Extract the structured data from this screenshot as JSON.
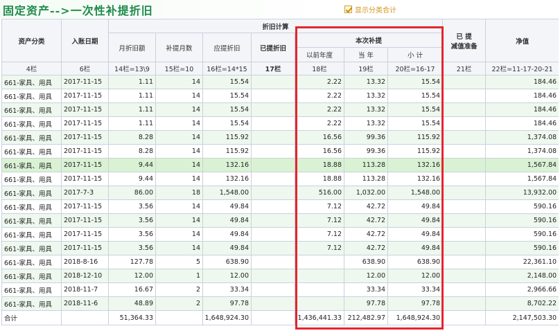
{
  "header": {
    "title": "固定资产-->一次性补提折旧",
    "summary_toggle": {
      "label": "显示分类合计",
      "checked": true
    }
  },
  "columns": {
    "category": "资产分类",
    "entry_date": "入账日期",
    "depr_group": "折旧计算",
    "monthly_depr": "月折旧额",
    "months": "补提月数",
    "due_depr": "应提折旧",
    "accrued_depr": "已提折旧",
    "current_group": "本次补提",
    "prior_years": "以前年度",
    "this_year": "当 年",
    "subtotal": "小 计",
    "impairment_top": "已 提",
    "impairment_bottom": "减值准备",
    "net_value": "净值"
  },
  "formula_row": [
    "4栏",
    "6栏",
    "14栏=13\\9",
    "15栏=10",
    "16栏=14*15",
    "17栏",
    "18栏",
    "19栏",
    "20栏=16-17",
    "21栏",
    "22栏=11-17-20-21"
  ],
  "rows": [
    {
      "category": "661-家具、用具",
      "entry_date": "2017-11-15",
      "monthly_depr": "1.11",
      "months": "14",
      "due_depr": "15.54",
      "accrued_depr": "",
      "prior_years": "2.22",
      "this_year": "13.32",
      "subtotal": "15.54",
      "impairment": "",
      "net_value": "184.46"
    },
    {
      "category": "661-家具、用具",
      "entry_date": "2017-11-15",
      "monthly_depr": "1.11",
      "months": "14",
      "due_depr": "15.54",
      "accrued_depr": "",
      "prior_years": "2.22",
      "this_year": "13.32",
      "subtotal": "15.54",
      "impairment": "",
      "net_value": "184.46"
    },
    {
      "category": "661-家具、用具",
      "entry_date": "2017-11-15",
      "monthly_depr": "1.11",
      "months": "14",
      "due_depr": "15.54",
      "accrued_depr": "",
      "prior_years": "2.22",
      "this_year": "13.32",
      "subtotal": "15.54",
      "impairment": "",
      "net_value": "184.46"
    },
    {
      "category": "661-家具、用具",
      "entry_date": "2017-11-15",
      "monthly_depr": "1.11",
      "months": "14",
      "due_depr": "15.54",
      "accrued_depr": "",
      "prior_years": "2.22",
      "this_year": "13.32",
      "subtotal": "15.54",
      "impairment": "",
      "net_value": "184.46"
    },
    {
      "category": "661-家具、用具",
      "entry_date": "2017-11-15",
      "monthly_depr": "8.28",
      "months": "14",
      "due_depr": "115.92",
      "accrued_depr": "",
      "prior_years": "16.56",
      "this_year": "99.36",
      "subtotal": "115.92",
      "impairment": "",
      "net_value": "1,374.08"
    },
    {
      "category": "661-家具、用具",
      "entry_date": "2017-11-15",
      "monthly_depr": "8.28",
      "months": "14",
      "due_depr": "115.92",
      "accrued_depr": "",
      "prior_years": "16.56",
      "this_year": "99.36",
      "subtotal": "115.92",
      "impairment": "",
      "net_value": "1,374.08"
    },
    {
      "category": "661-家具、用具",
      "entry_date": "2017-11-15",
      "monthly_depr": "9.44",
      "months": "14",
      "due_depr": "132.16",
      "accrued_depr": "",
      "prior_years": "18.88",
      "this_year": "113.28",
      "subtotal": "132.16",
      "impairment": "",
      "net_value": "1,567.84",
      "selected": true
    },
    {
      "category": "661-家具、用具",
      "entry_date": "2017-11-15",
      "monthly_depr": "9.44",
      "months": "14",
      "due_depr": "132.16",
      "accrued_depr": "",
      "prior_years": "18.88",
      "this_year": "113.28",
      "subtotal": "132.16",
      "impairment": "",
      "net_value": "1,567.84"
    },
    {
      "category": "661-家具、用具",
      "entry_date": "2017-7-3",
      "monthly_depr": "86.00",
      "months": "18",
      "due_depr": "1,548.00",
      "accrued_depr": "",
      "prior_years": "516.00",
      "this_year": "1,032.00",
      "subtotal": "1,548.00",
      "impairment": "",
      "net_value": "13,932.00"
    },
    {
      "category": "661-家具、用具",
      "entry_date": "2017-11-15",
      "monthly_depr": "3.56",
      "months": "14",
      "due_depr": "49.84",
      "accrued_depr": "",
      "prior_years": "7.12",
      "this_year": "42.72",
      "subtotal": "49.84",
      "impairment": "",
      "net_value": "590.16"
    },
    {
      "category": "661-家具、用具",
      "entry_date": "2017-11-15",
      "monthly_depr": "3.56",
      "months": "14",
      "due_depr": "49.84",
      "accrued_depr": "",
      "prior_years": "7.12",
      "this_year": "42.72",
      "subtotal": "49.84",
      "impairment": "",
      "net_value": "590.16"
    },
    {
      "category": "661-家具、用具",
      "entry_date": "2017-11-15",
      "monthly_depr": "3.56",
      "months": "14",
      "due_depr": "49.84",
      "accrued_depr": "",
      "prior_years": "7.12",
      "this_year": "42.72",
      "subtotal": "49.84",
      "impairment": "",
      "net_value": "590.16"
    },
    {
      "category": "661-家具、用具",
      "entry_date": "2017-11-15",
      "monthly_depr": "3.56",
      "months": "14",
      "due_depr": "49.84",
      "accrued_depr": "",
      "prior_years": "7.12",
      "this_year": "42.72",
      "subtotal": "49.84",
      "impairment": "",
      "net_value": "590.16"
    },
    {
      "category": "661-家具、用具",
      "entry_date": "2018-8-16",
      "monthly_depr": "127.78",
      "months": "5",
      "due_depr": "638.90",
      "accrued_depr": "",
      "prior_years": "",
      "this_year": "638.90",
      "subtotal": "638.90",
      "impairment": "",
      "net_value": "22,361.10"
    },
    {
      "category": "661-家具、用具",
      "entry_date": "2018-12-10",
      "monthly_depr": "12.00",
      "months": "1",
      "due_depr": "12.00",
      "accrued_depr": "",
      "prior_years": "",
      "this_year": "12.00",
      "subtotal": "12.00",
      "impairment": "",
      "net_value": "2,148.00"
    },
    {
      "category": "661-家具、用具",
      "entry_date": "2018-11-7",
      "monthly_depr": "16.67",
      "months": "2",
      "due_depr": "33.34",
      "accrued_depr": "",
      "prior_years": "",
      "this_year": "33.34",
      "subtotal": "33.34",
      "impairment": "",
      "net_value": "2,966.66"
    },
    {
      "category": "661-家具、用具",
      "entry_date": "2018-11-6",
      "monthly_depr": "48.89",
      "months": "2",
      "due_depr": "97.78",
      "accrued_depr": "",
      "prior_years": "",
      "this_year": "97.78",
      "subtotal": "97.78",
      "impairment": "",
      "net_value": "8,702.22"
    }
  ],
  "total": {
    "label": "合计",
    "entry_date": "",
    "monthly_depr": "51,364.33",
    "months": "",
    "due_depr": "1,648,924.30",
    "accrued_depr": "",
    "prior_years": "1,436,441.33",
    "this_year": "212,482.97",
    "subtotal": "1,648,924.30",
    "impairment": "",
    "net_value": "2,147,503.30"
  },
  "colors": {
    "title": "#1f8a4c",
    "highlight_frame": "#e3262f",
    "row_alt": "#eef8ee",
    "row_selected": "#d9f2d4",
    "toggle_label": "#d2951e"
  }
}
